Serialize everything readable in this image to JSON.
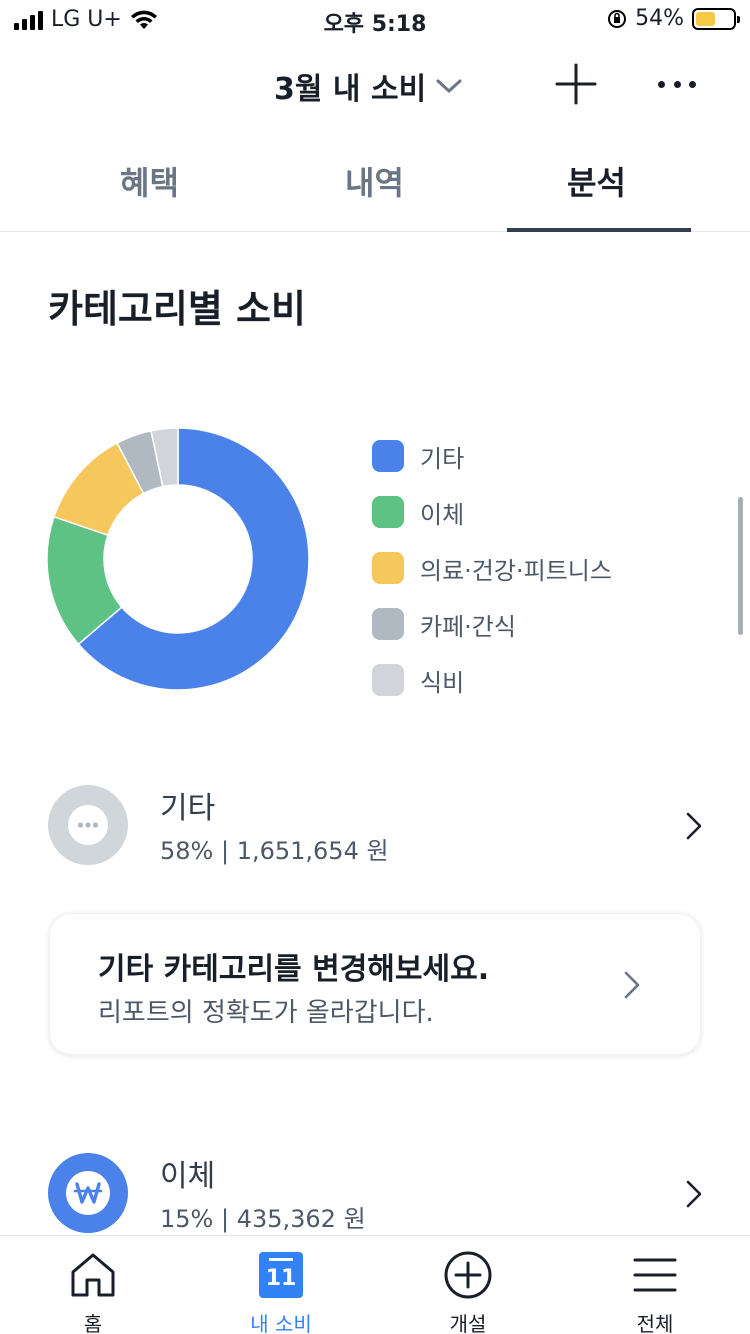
{
  "status_bar": {
    "carrier": "LG U+",
    "time": "오후 5:18",
    "battery_percent": "54%",
    "battery_level": 0.54
  },
  "header": {
    "title": "3월 내 소비",
    "icons": [
      "chevron-down-icon",
      "plus-icon",
      "more-icon"
    ]
  },
  "tabs": [
    {
      "label": "혜택",
      "active": false
    },
    {
      "label": "내역",
      "active": false
    },
    {
      "label": "분석",
      "active": true
    }
  ],
  "section_title": "카테고리별 소비",
  "chart_data": {
    "type": "pie",
    "style": "donut",
    "categories": [
      "기타",
      "이체",
      "의료·건강·피트니스",
      "카페·간식",
      "식비"
    ],
    "values": [
      58,
      15,
      11,
      4,
      3
    ],
    "colors": [
      "#4a82ea",
      "#5ec285",
      "#f6c75c",
      "#b0b8c1",
      "#d1d5db"
    ],
    "legend_position": "right"
  },
  "categories": [
    {
      "name": "기타",
      "detail": "58% | 1,651,654 원",
      "icon": "more-icon",
      "icon_bg": "#d1d6db"
    },
    {
      "name": "이체",
      "detail": "15% | 435,362 원",
      "icon": "won-icon",
      "icon_bg": "#4a82ea"
    }
  ],
  "tip": {
    "title": "기타 카테고리를 변경해보세요.",
    "subtitle": "리포트의 정확도가 올라갑니다."
  },
  "bottom_nav": [
    {
      "label": "홈",
      "icon": "home-icon",
      "active": false
    },
    {
      "label": "내 소비",
      "icon": "calendar-icon",
      "icon_text": "11",
      "active": true
    },
    {
      "label": "개설",
      "icon": "plus-circle-icon",
      "active": false
    },
    {
      "label": "전체",
      "icon": "menu-icon",
      "active": false
    }
  ]
}
